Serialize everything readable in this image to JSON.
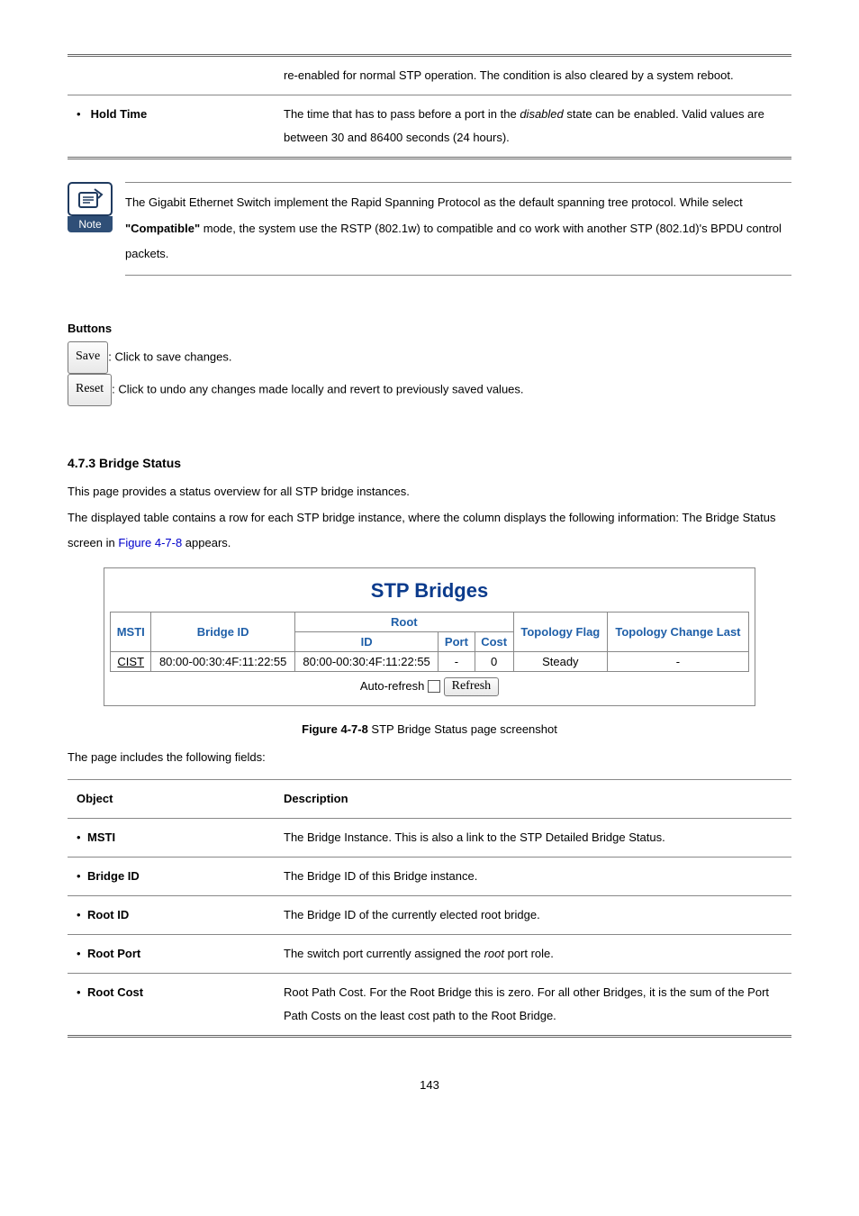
{
  "top_table": {
    "row1": {
      "desc": "re-enabled for normal STP operation. The condition is also cleared by a system reboot."
    },
    "row2": {
      "label": "Hold Time",
      "desc_a": "The time that has to pass before a port in the ",
      "desc_em": "disabled",
      "desc_b": " state can be enabled. Valid values are between 30 and 86400 seconds (24 hours)."
    }
  },
  "note": {
    "label": "Note",
    "text_a": "The Gigabit Ethernet Switch implement the Rapid Spanning Protocol as the default spanning tree protocol. While select ",
    "text_bold": "\"Compatible\"",
    "text_b": " mode, the system use the RSTP (802.1w) to compatible and co work with another STP (802.1d)'s BPDU control packets."
  },
  "buttons_heading": "Buttons",
  "save_btn": "Save",
  "save_desc": ": Click to save changes.",
  "reset_btn": "Reset",
  "reset_desc": ": Click to undo any changes made locally and revert to previously saved values.",
  "section_heading": "4.7.3 Bridge Status",
  "body1": "This page provides a status overview for all STP bridge instances.",
  "body2_a": "The displayed table contains a row for each STP bridge instance, where the column displays the following information: The Bridge Status screen in ",
  "body2_link": "Figure 4-7-8",
  "body2_b": " appears.",
  "fig": {
    "title": "STP Bridges",
    "headers": {
      "msti": "MSTI",
      "bridge_id": "Bridge ID",
      "root": "Root",
      "id": "ID",
      "port": "Port",
      "cost": "Cost",
      "topo_flag": "Topology Flag",
      "topo_change": "Topology Change Last"
    },
    "row": {
      "msti": "CIST",
      "bridge_id": "80:00-00:30:4F:11:22:55",
      "root_id": "80:00-00:30:4F:11:22:55",
      "port": "-",
      "cost": "0",
      "flag": "Steady",
      "change": "-"
    },
    "auto_refresh": "Auto-refresh",
    "refresh_btn": "Refresh"
  },
  "fig_caption_b": " STP Bridge Status page screenshot",
  "fig_caption_bold": "Figure 4-7-8",
  "fields_intro": "The page includes the following fields:",
  "fields_table": {
    "h_object": "Object",
    "h_desc": "Description",
    "r1_obj": "MSTI",
    "r1_desc": "The Bridge Instance. This is also a link to the STP Detailed Bridge Status.",
    "r2_obj": "Bridge ID",
    "r2_desc": "The Bridge ID of this Bridge instance.",
    "r3_obj": "Root ID",
    "r3_desc": "The Bridge ID of the currently elected root bridge.",
    "r4_obj": "Root Port",
    "r4_desc_a": "The switch port currently assigned the ",
    "r4_desc_em": "root",
    "r4_desc_b": " port role.",
    "r5_obj": "Root Cost",
    "r5_desc": "Root Path Cost. For the Root Bridge this is zero. For all other Bridges, it is the sum of the Port Path Costs on the least cost path to the Root Bridge."
  },
  "page_number": "143"
}
